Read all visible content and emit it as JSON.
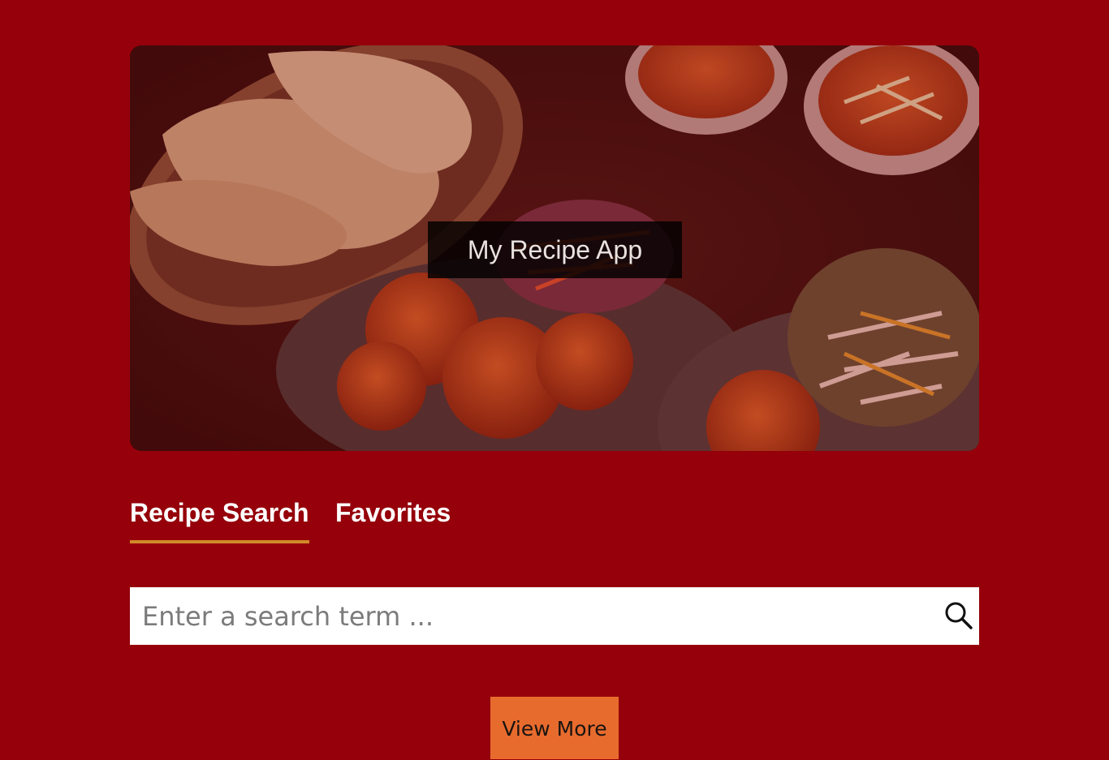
{
  "hero": {
    "title": "My Recipe App",
    "image": "indian-food-platter-photo"
  },
  "tabs": [
    {
      "label": "Recipe Search",
      "active": true
    },
    {
      "label": "Favorites",
      "active": false
    }
  ],
  "search": {
    "placeholder": "Enter a search term ...",
    "value": "",
    "icon": "search-icon"
  },
  "actions": {
    "view_more_label": "View More"
  },
  "colors": {
    "background": "#95000a",
    "tab_underline": "#d18a2a",
    "button": "#e86b2e"
  }
}
